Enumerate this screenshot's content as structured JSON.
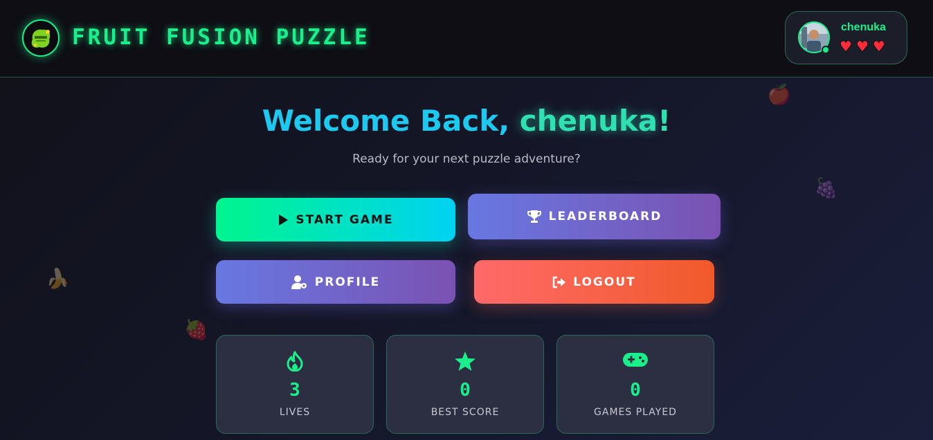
{
  "header": {
    "title": "FRUIT FUSION PUZZLE",
    "logo_icon": "fruit-logo-icon",
    "user": {
      "name": "chenuka",
      "lives": 3,
      "heart_icon": "heart-icon"
    }
  },
  "main": {
    "welcome_prefix": "Welcome Back, ",
    "welcome_name": "chenuka",
    "welcome_suffix": "!",
    "subtitle": "Ready for your next puzzle adventure?"
  },
  "buttons": {
    "start": "START GAME",
    "leaderboard": "LEADERBOARD",
    "profile": "PROFILE",
    "logout": "LOGOUT"
  },
  "stats": [
    {
      "value": "3",
      "label": "LIVES",
      "icon": "flame-icon"
    },
    {
      "value": "0",
      "label": "BEST SCORE",
      "icon": "star-icon"
    },
    {
      "value": "0",
      "label": "GAMES PLAYED",
      "icon": "gamepad-icon"
    }
  ],
  "colors": {
    "accent": "#19f08c",
    "cyan": "#1ec9f0",
    "purple": "#7a52b2",
    "logout": "#f05a2a"
  }
}
